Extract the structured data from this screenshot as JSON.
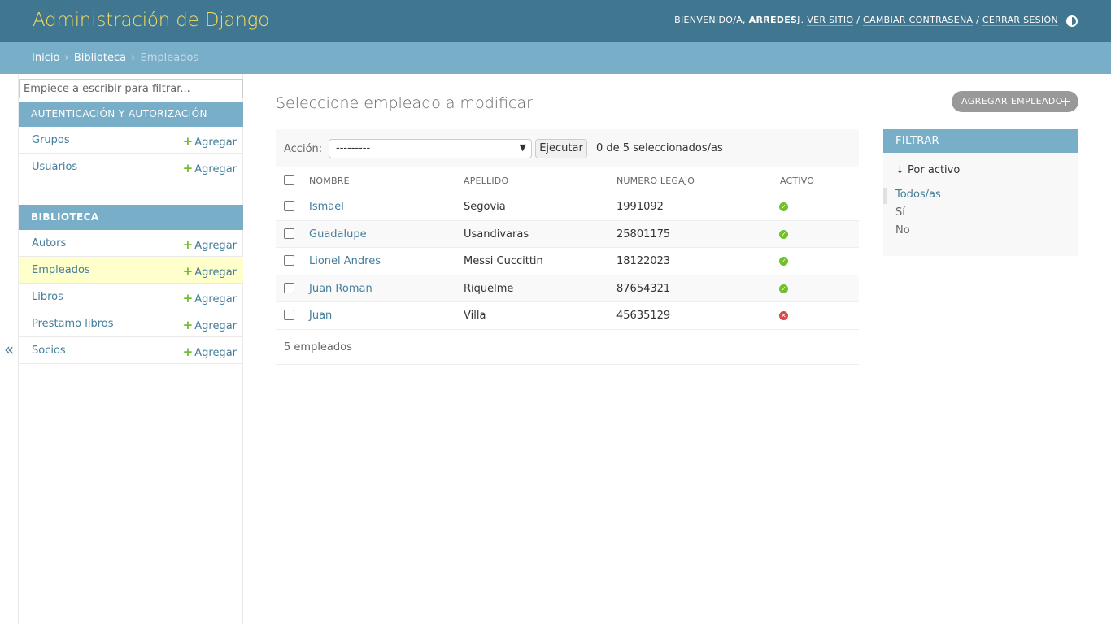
{
  "header": {
    "title": "Administración de Django",
    "welcome": "BIENVENIDO/A,",
    "username": "ARREDESJ",
    "view_site": "VER SITIO",
    "change_password": "CAMBIAR CONTRASEÑA",
    "logout": "CERRAR SESIÓN",
    "separator": "/",
    "theme_icon": "half-circle-icon"
  },
  "breadcrumbs": {
    "home": "Inicio",
    "app": "Biblioteca",
    "current": "Empleados",
    "separator": "›"
  },
  "sidebar": {
    "filter_placeholder": "Empiece a escribir para filtrar...",
    "apps": [
      {
        "caption": "AUTENTICACIÓN Y AUTORIZACIÓN",
        "models": [
          {
            "name": "Grupos",
            "add": "Agregar"
          },
          {
            "name": "Usuarios",
            "add": "Agregar"
          }
        ]
      },
      {
        "caption": "BIBLIOTECA",
        "models": [
          {
            "name": "Autors",
            "add": "Agregar"
          },
          {
            "name": "Empleados",
            "add": "Agregar"
          },
          {
            "name": "Libros",
            "add": "Agregar"
          },
          {
            "name": "Prestamo libros",
            "add": "Agregar"
          },
          {
            "name": "Socios",
            "add": "Agregar"
          }
        ]
      }
    ],
    "collapse_glyph": "«"
  },
  "content": {
    "title": "Seleccione empleado a modificar",
    "add_button": "AGREGAR EMPLEADO",
    "actions": {
      "label": "Acción:",
      "selected": "---------",
      "go": "Ejecutar",
      "counter": "0 de 5 seleccionados/as"
    },
    "table": {
      "headers": [
        "NOMBRE",
        "APELLIDO",
        "NUMERO LEGAJO",
        "ACTIVO"
      ],
      "rows": [
        {
          "nombre": "Ismael",
          "apellido": "Segovia",
          "legajo": "1991092",
          "activo": true
        },
        {
          "nombre": "Guadalupe",
          "apellido": "Usandivaras",
          "legajo": "25801175",
          "activo": true
        },
        {
          "nombre": "Lionel Andres",
          "apellido": "Messi Cuccittin",
          "legajo": "18122023",
          "activo": true
        },
        {
          "nombre": "Juan Roman",
          "apellido": "Riquelme",
          "legajo": "87654321",
          "activo": true
        },
        {
          "nombre": "Juan",
          "apellido": "Villa",
          "legajo": "45635129",
          "activo": false
        }
      ]
    },
    "paginator": "5 empleados"
  },
  "filter": {
    "title": "FILTRAR",
    "by": "↓ Por activo",
    "options": [
      "Todos/as",
      "Sí",
      "No"
    ],
    "selected_index": 0
  },
  "colors": {
    "header_bg": "#417690",
    "brand": "#f5dd5d",
    "accent": "#79aec8",
    "link": "#447e9b",
    "yes": "#70bf2b",
    "no": "#dd4646"
  }
}
